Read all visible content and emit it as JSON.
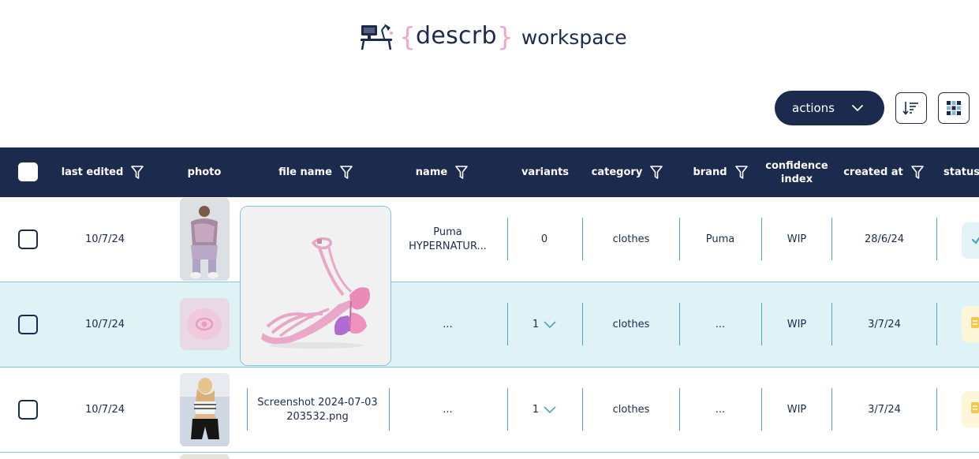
{
  "app": {
    "logo_brace_open": "{",
    "logo_word": "descrb",
    "logo_brace_close": "}",
    "logo_suffix": "workspace",
    "logo_icon": "desk-lamp-icon"
  },
  "toolbar": {
    "actions_label": "actions",
    "actions_icon": "chevron-down-icon",
    "sort_icon": "sort-icon",
    "grid_icon": "grid-view-icon"
  },
  "table": {
    "columns": {
      "last_edited": "last edited",
      "photo": "photo",
      "file_name": "file name",
      "name": "name",
      "variants": "variants",
      "category": "category",
      "brand": "brand",
      "confidence_line1": "confidence",
      "confidence_line2": "index",
      "created_at": "created at",
      "status": "status"
    },
    "rows": [
      {
        "last_edited": "10/7/24",
        "file_name": "",
        "name_line1": "Puma",
        "name_line2": "HYPERNATUR...",
        "variants": "0",
        "category": "clothes",
        "brand": "Puma",
        "confidence": "WIP",
        "created_at": "28/6/24"
      },
      {
        "last_edited": "10/7/24",
        "file_name": "",
        "name": "...",
        "variants": "1",
        "category": "clothes",
        "brand": "...",
        "confidence": "WIP",
        "created_at": "3/7/24"
      },
      {
        "last_edited": "10/7/24",
        "file_name_line1": "Screenshot 2024-07-03",
        "file_name_line2": "203532.png",
        "name": "...",
        "variants": "1",
        "category": "clothes",
        "brand": "...",
        "confidence": "WIP",
        "created_at": "3/7/24"
      }
    ]
  },
  "colors": {
    "navy": "#1c2a4d",
    "pink_brace": "#f3a6c8",
    "row_highlight": "#dff3f7",
    "separator": "#4fa7bd"
  }
}
